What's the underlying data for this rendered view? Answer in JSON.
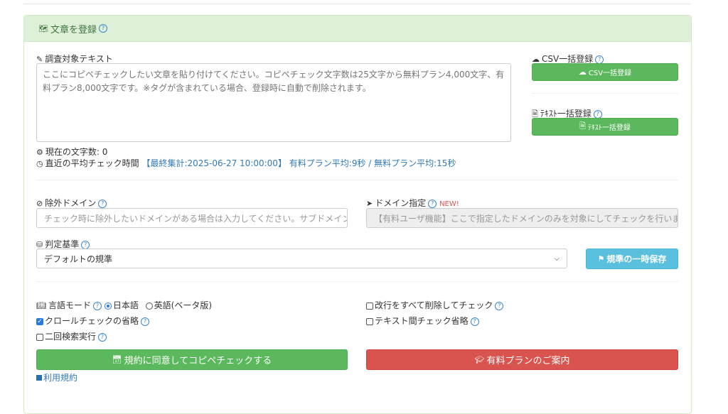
{
  "panel": {
    "title": "文章を登録"
  },
  "text_section": {
    "label": "調査対象テキスト",
    "placeholder": "ここにコピペチェックしたい文章を貼り付けてください。コピペチェック文字数は25文字から無料プラン4,000文字、有料プラン8,000文字です。※タグが含まれている場合、登録時に自動で削除されます。",
    "char_count_label": "現在の文字数: 0",
    "avg_time_label": "直近の平均チェック時間",
    "avg_time_updated": "【最終集計:2025-06-27 10:00:00】",
    "avg_time_values": "有料プラン平均:9秒 / 無料プラン平均:15秒"
  },
  "side": {
    "csv_label": "CSV一括登録",
    "csv_button": "CSV一括登録",
    "text_label": "ﾃｷｽﾄ一括登録",
    "text_button": "ﾃｷｽﾄ一括登録"
  },
  "exclude_domain": {
    "label": "除外ドメイン",
    "placeholder": "チェック時に除外したいドメインがある場合は入力してください。サブドメイン"
  },
  "target_domain": {
    "label": "ドメイン指定",
    "badge": "NEW!",
    "placeholder": "【有料ユーザ機能】ここで指定したドメインのみを対象にしてチェックを行います"
  },
  "criteria": {
    "label": "判定基準",
    "selected": "デフォルトの規準",
    "save_button": "規準の一時保存"
  },
  "options": {
    "lang_label": "言語モード",
    "lang_ja": "日本語",
    "lang_en": "英語(ベータ版)",
    "skip_crawl": "クロールチェックの省略",
    "double_search": "二回検索実行",
    "remove_newlines": "改行をすべて削除してチェック",
    "skip_inter_text": "テキスト間チェック省略"
  },
  "actions": {
    "submit": "規約に同意してコピペチェックする",
    "paid_plan": "有料プランのご案内",
    "terms_link": "利用規約"
  },
  "colors": {
    "green": "#5cb85c",
    "red": "#d9534f",
    "info_blue": "#5bc0de",
    "panel_head": "#dff0d8"
  }
}
